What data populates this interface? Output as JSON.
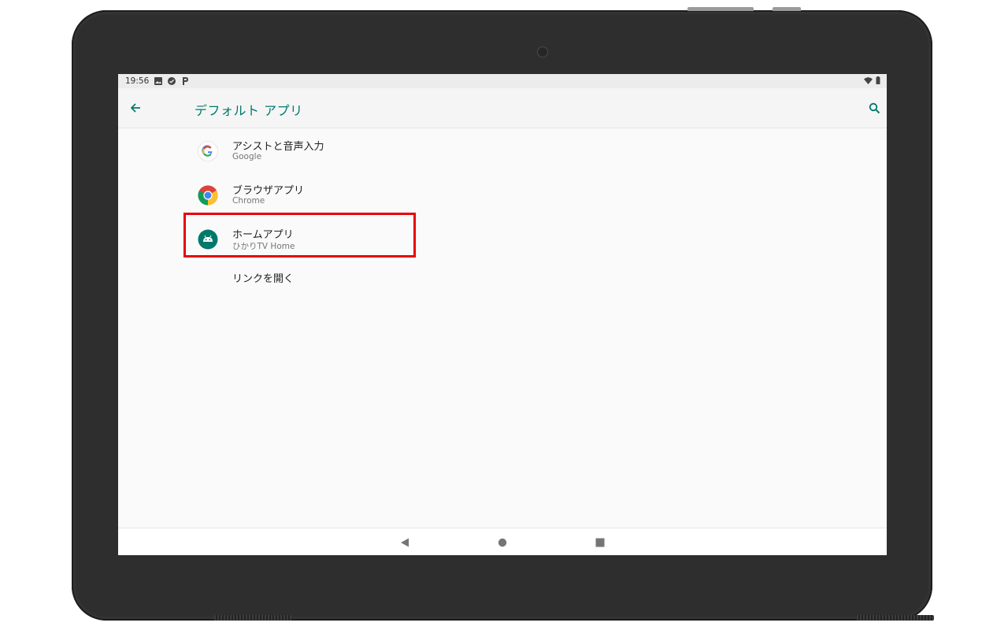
{
  "status_bar": {
    "time": "19:56",
    "left_icons": [
      "image-icon",
      "check-circle-icon",
      "p-icon"
    ],
    "right_icons": [
      "wifi-icon",
      "battery-icon"
    ]
  },
  "app_bar": {
    "title": "デフォルト アプリ",
    "accent_color": "#00796b"
  },
  "items": [
    {
      "title": "アシストと音声入力",
      "subtitle": "Google",
      "icon": "google-icon"
    },
    {
      "title": "ブラウザアプリ",
      "subtitle": "Chrome",
      "icon": "chrome-icon"
    },
    {
      "title": "ホームアプリ",
      "subtitle": "ひかりTV Home",
      "icon": "android-icon"
    },
    {
      "title": "リンクを開く",
      "subtitle": "",
      "icon": ""
    }
  ],
  "highlight": {
    "color": "#e8000b",
    "target": "ホームアプリ"
  },
  "nav_bar": {
    "buttons": [
      "back-triangle-icon",
      "home-circle-icon",
      "recents-square-icon"
    ]
  }
}
